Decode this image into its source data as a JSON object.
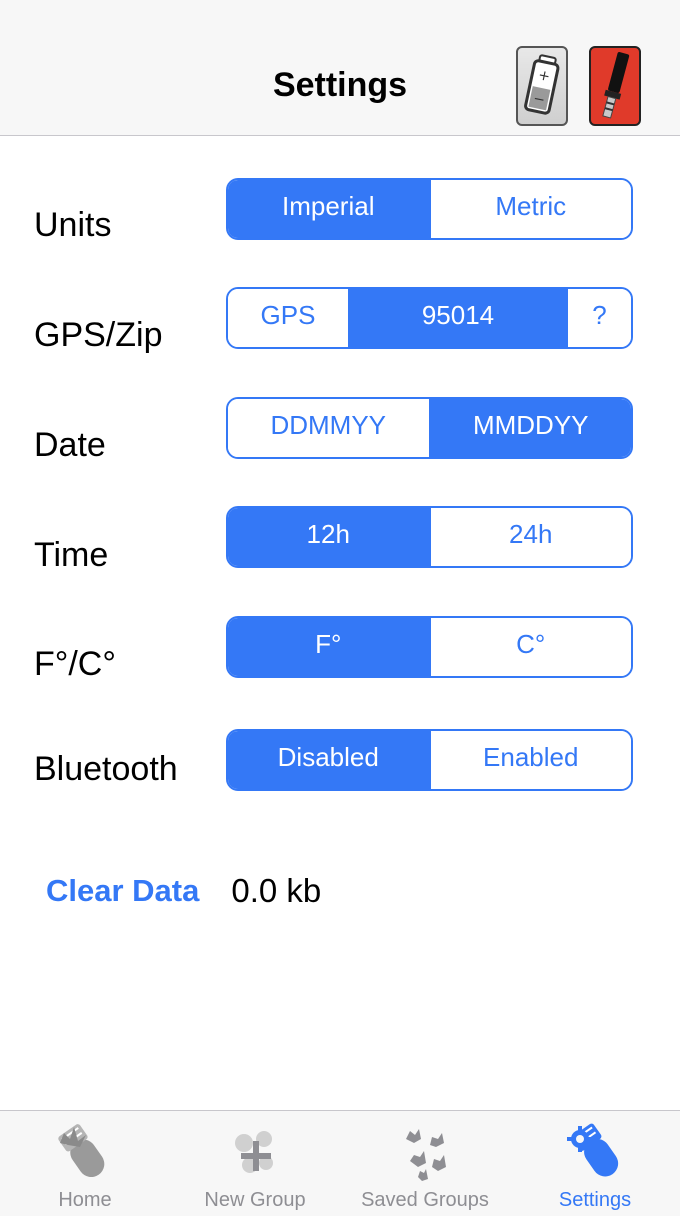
{
  "nav": {
    "title": "Settings"
  },
  "settings": {
    "units": {
      "label": "Units",
      "options": [
        "Imperial",
        "Metric"
      ],
      "selected": "Imperial"
    },
    "location": {
      "label": "GPS/Zip",
      "gps": "GPS",
      "zip": "95014",
      "help": "?",
      "selected": "95014"
    },
    "date": {
      "label": "Date",
      "options": [
        "DDMMYY",
        "MMDDYY"
      ],
      "selected": "MMDDYY"
    },
    "time": {
      "label": "Time",
      "options": [
        "12h",
        "24h"
      ],
      "selected": "12h"
    },
    "temperature": {
      "label": "F°/C°",
      "options": [
        "F°",
        "C°"
      ],
      "selected": "F°"
    },
    "bluetooth": {
      "label": "Bluetooth",
      "options": [
        "Disabled",
        "Enabled"
      ],
      "selected": "Disabled"
    }
  },
  "storage": {
    "clear_label": "Clear Data",
    "size": "0.0 kb"
  },
  "tabs": [
    {
      "label": "Home",
      "icon": "home-splat-icon",
      "active": false
    },
    {
      "label": "New Group",
      "icon": "new-group-plus-icon",
      "active": false
    },
    {
      "label": "Saved Groups",
      "icon": "saved-groups-icon",
      "active": false
    },
    {
      "label": "Settings",
      "icon": "settings-gear-icon",
      "active": true
    }
  ],
  "colors": {
    "accent": "#3478f6",
    "inactive": "#8e8e93",
    "probe": "#e03a2a"
  }
}
